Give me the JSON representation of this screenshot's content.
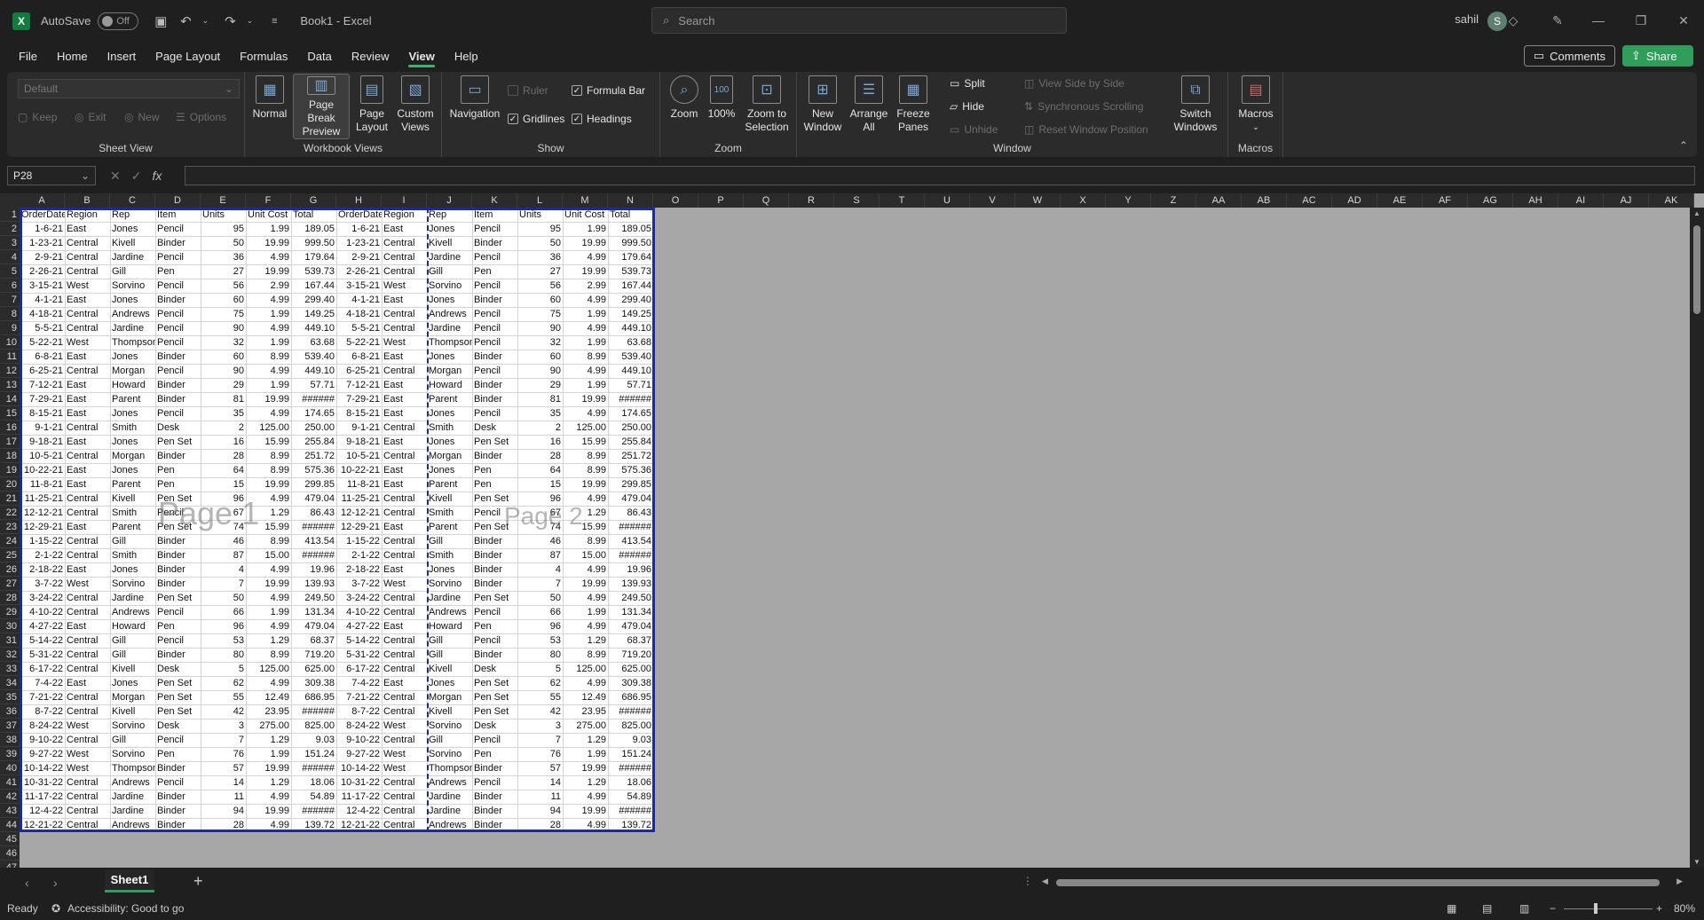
{
  "titlebar": {
    "autosave_label": "AutoSave",
    "autosave_state": "Off",
    "document_title": "Book1  -  Excel",
    "search_placeholder": "Search",
    "user_name": "sahil",
    "user_initial": "S"
  },
  "menu": {
    "items": [
      "File",
      "Home",
      "Insert",
      "Page Layout",
      "Formulas",
      "Data",
      "Review",
      "View",
      "Help"
    ],
    "active": "View",
    "comments_label": "Comments",
    "share_label": "Share"
  },
  "ribbon": {
    "sheet_view": {
      "select_value": "Default",
      "keep": "Keep",
      "exit": "Exit",
      "new": "New",
      "options": "Options",
      "group_label": "Sheet View"
    },
    "workbook_views": {
      "normal": "Normal",
      "page_break_preview_1": "Page Break",
      "page_break_preview_2": "Preview",
      "page_layout_1": "Page",
      "page_layout_2": "Layout",
      "custom_views_1": "Custom",
      "custom_views_2": "Views",
      "group_label": "Workbook Views"
    },
    "show": {
      "navigation": "Navigation",
      "ruler": "Ruler",
      "formula_bar": "Formula Bar",
      "gridlines": "Gridlines",
      "headings": "Headings",
      "group_label": "Show"
    },
    "zoom": {
      "zoom": "Zoom",
      "hundred": "100%",
      "zoom_sel_1": "Zoom to",
      "zoom_sel_2": "Selection",
      "group_label": "Zoom"
    },
    "window": {
      "new_window_1": "New",
      "new_window_2": "Window",
      "arrange_all_1": "Arrange",
      "arrange_all_2": "All",
      "freeze_1": "Freeze",
      "freeze_2": "Panes",
      "split": "Split",
      "hide": "Hide",
      "unhide": "Unhide",
      "view_side": "View Side by Side",
      "sync_scroll": "Synchronous Scrolling",
      "reset_pos": "Reset Window Position",
      "switch_1": "Switch",
      "switch_2": "Windows",
      "group_label": "Window"
    },
    "macros": {
      "macros": "Macros",
      "group_label": "Macros"
    }
  },
  "formula_bar": {
    "name_box": "P28",
    "fx": "fx"
  },
  "columns": [
    "A",
    "B",
    "C",
    "D",
    "E",
    "F",
    "G",
    "H",
    "I",
    "J",
    "K",
    "L",
    "M",
    "N",
    "O",
    "P",
    "Q",
    "R",
    "S",
    "T",
    "U",
    "V",
    "W",
    "X",
    "Y",
    "Z",
    "AA",
    "AB",
    "AC",
    "AD",
    "AE",
    "AF",
    "AG",
    "AH",
    "AI",
    "AJ",
    "AK"
  ],
  "sheet": {
    "headers": [
      "OrderDate",
      "Region",
      "Rep",
      "Item",
      "Units",
      "Unit Cost",
      "Total"
    ],
    "rows": [
      [
        "1-6-21",
        "East",
        "Jones",
        "Pencil",
        "95",
        "1.99",
        "189.05"
      ],
      [
        "1-23-21",
        "Central",
        "Kivell",
        "Binder",
        "50",
        "19.99",
        "999.50"
      ],
      [
        "2-9-21",
        "Central",
        "Jardine",
        "Pencil",
        "36",
        "4.99",
        "179.64"
      ],
      [
        "2-26-21",
        "Central",
        "Gill",
        "Pen",
        "27",
        "19.99",
        "539.73"
      ],
      [
        "3-15-21",
        "West",
        "Sorvino",
        "Pencil",
        "56",
        "2.99",
        "167.44"
      ],
      [
        "4-1-21",
        "East",
        "Jones",
        "Binder",
        "60",
        "4.99",
        "299.40"
      ],
      [
        "4-18-21",
        "Central",
        "Andrews",
        "Pencil",
        "75",
        "1.99",
        "149.25"
      ],
      [
        "5-5-21",
        "Central",
        "Jardine",
        "Pencil",
        "90",
        "4.99",
        "449.10"
      ],
      [
        "5-22-21",
        "West",
        "Thompson",
        "Pencil",
        "32",
        "1.99",
        "63.68"
      ],
      [
        "6-8-21",
        "East",
        "Jones",
        "Binder",
        "60",
        "8.99",
        "539.40"
      ],
      [
        "6-25-21",
        "Central",
        "Morgan",
        "Pencil",
        "90",
        "4.99",
        "449.10"
      ],
      [
        "7-12-21",
        "East",
        "Howard",
        "Binder",
        "29",
        "1.99",
        "57.71"
      ],
      [
        "7-29-21",
        "East",
        "Parent",
        "Binder",
        "81",
        "19.99",
        "######"
      ],
      [
        "8-15-21",
        "East",
        "Jones",
        "Pencil",
        "35",
        "4.99",
        "174.65"
      ],
      [
        "9-1-21",
        "Central",
        "Smith",
        "Desk",
        "2",
        "125.00",
        "250.00"
      ],
      [
        "9-18-21",
        "East",
        "Jones",
        "Pen Set",
        "16",
        "15.99",
        "255.84"
      ],
      [
        "10-5-21",
        "Central",
        "Morgan",
        "Binder",
        "28",
        "8.99",
        "251.72"
      ],
      [
        "10-22-21",
        "East",
        "Jones",
        "Pen",
        "64",
        "8.99",
        "575.36"
      ],
      [
        "11-8-21",
        "East",
        "Parent",
        "Pen",
        "15",
        "19.99",
        "299.85"
      ],
      [
        "11-25-21",
        "Central",
        "Kivell",
        "Pen Set",
        "96",
        "4.99",
        "479.04"
      ],
      [
        "12-12-21",
        "Central",
        "Smith",
        "Pencil",
        "67",
        "1.29",
        "86.43"
      ],
      [
        "12-29-21",
        "East",
        "Parent",
        "Pen Set",
        "74",
        "15.99",
        "######"
      ],
      [
        "1-15-22",
        "Central",
        "Gill",
        "Binder",
        "46",
        "8.99",
        "413.54"
      ],
      [
        "2-1-22",
        "Central",
        "Smith",
        "Binder",
        "87",
        "15.00",
        "######"
      ],
      [
        "2-18-22",
        "East",
        "Jones",
        "Binder",
        "4",
        "4.99",
        "19.96"
      ],
      [
        "3-7-22",
        "West",
        "Sorvino",
        "Binder",
        "7",
        "19.99",
        "139.93"
      ],
      [
        "3-24-22",
        "Central",
        "Jardine",
        "Pen Set",
        "50",
        "4.99",
        "249.50"
      ],
      [
        "4-10-22",
        "Central",
        "Andrews",
        "Pencil",
        "66",
        "1.99",
        "131.34"
      ],
      [
        "4-27-22",
        "East",
        "Howard",
        "Pen",
        "96",
        "4.99",
        "479.04"
      ],
      [
        "5-14-22",
        "Central",
        "Gill",
        "Pencil",
        "53",
        "1.29",
        "68.37"
      ],
      [
        "5-31-22",
        "Central",
        "Gill",
        "Binder",
        "80",
        "8.99",
        "719.20"
      ],
      [
        "6-17-22",
        "Central",
        "Kivell",
        "Desk",
        "5",
        "125.00",
        "625.00"
      ],
      [
        "7-4-22",
        "East",
        "Jones",
        "Pen Set",
        "62",
        "4.99",
        "309.38"
      ],
      [
        "7-21-22",
        "Central",
        "Morgan",
        "Pen Set",
        "55",
        "12.49",
        "686.95"
      ],
      [
        "8-7-22",
        "Central",
        "Kivell",
        "Pen Set",
        "42",
        "23.95",
        "######"
      ],
      [
        "8-24-22",
        "West",
        "Sorvino",
        "Desk",
        "3",
        "275.00",
        "825.00"
      ],
      [
        "9-10-22",
        "Central",
        "Gill",
        "Pencil",
        "7",
        "1.29",
        "9.03"
      ],
      [
        "9-27-22",
        "West",
        "Sorvino",
        "Pen",
        "76",
        "1.99",
        "151.24"
      ],
      [
        "10-14-22",
        "West",
        "Thompson",
        "Binder",
        "57",
        "19.99",
        "######"
      ],
      [
        "10-31-22",
        "Central",
        "Andrews",
        "Pencil",
        "14",
        "1.29",
        "18.06"
      ],
      [
        "11-17-22",
        "Central",
        "Jardine",
        "Binder",
        "11",
        "4.99",
        "54.89"
      ],
      [
        "12-4-22",
        "Central",
        "Jardine",
        "Binder",
        "94",
        "19.99",
        "######"
      ],
      [
        "12-21-22",
        "Central",
        "Andrews",
        "Binder",
        "28",
        "4.99",
        "139.72"
      ]
    ],
    "page1_label": "Page 1",
    "page2_label": "Page 2"
  },
  "tabs": {
    "sheet_name": "Sheet1"
  },
  "status": {
    "ready": "Ready",
    "accessibility": "Accessibility: Good to go",
    "zoom_level": "80%"
  }
}
